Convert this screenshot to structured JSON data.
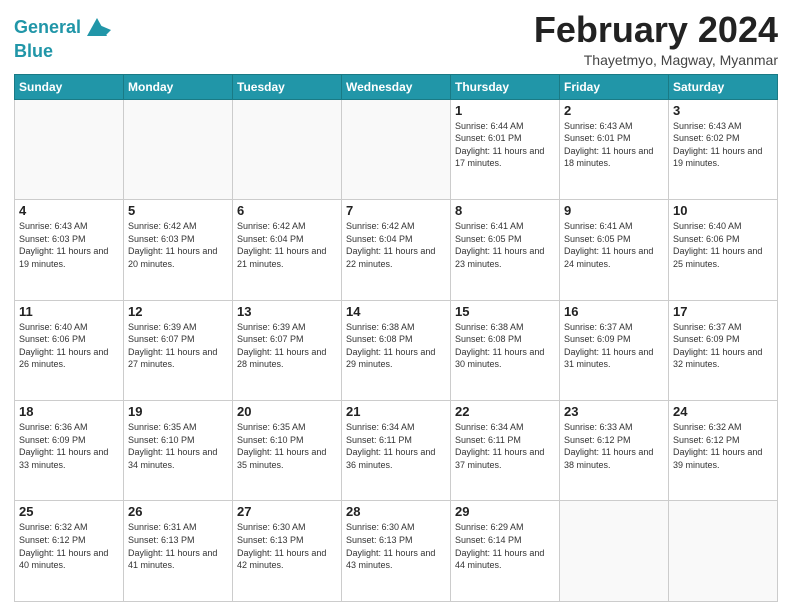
{
  "header": {
    "logo_line1": "General",
    "logo_line2": "Blue",
    "title": "February 2024",
    "subtitle": "Thayetmyo, Magway, Myanmar"
  },
  "days_of_week": [
    "Sunday",
    "Monday",
    "Tuesday",
    "Wednesday",
    "Thursday",
    "Friday",
    "Saturday"
  ],
  "weeks": [
    [
      {
        "day": "",
        "info": ""
      },
      {
        "day": "",
        "info": ""
      },
      {
        "day": "",
        "info": ""
      },
      {
        "day": "",
        "info": ""
      },
      {
        "day": "1",
        "info": "Sunrise: 6:44 AM\nSunset: 6:01 PM\nDaylight: 11 hours and 17 minutes."
      },
      {
        "day": "2",
        "info": "Sunrise: 6:43 AM\nSunset: 6:01 PM\nDaylight: 11 hours and 18 minutes."
      },
      {
        "day": "3",
        "info": "Sunrise: 6:43 AM\nSunset: 6:02 PM\nDaylight: 11 hours and 19 minutes."
      }
    ],
    [
      {
        "day": "4",
        "info": "Sunrise: 6:43 AM\nSunset: 6:03 PM\nDaylight: 11 hours and 19 minutes."
      },
      {
        "day": "5",
        "info": "Sunrise: 6:42 AM\nSunset: 6:03 PM\nDaylight: 11 hours and 20 minutes."
      },
      {
        "day": "6",
        "info": "Sunrise: 6:42 AM\nSunset: 6:04 PM\nDaylight: 11 hours and 21 minutes."
      },
      {
        "day": "7",
        "info": "Sunrise: 6:42 AM\nSunset: 6:04 PM\nDaylight: 11 hours and 22 minutes."
      },
      {
        "day": "8",
        "info": "Sunrise: 6:41 AM\nSunset: 6:05 PM\nDaylight: 11 hours and 23 minutes."
      },
      {
        "day": "9",
        "info": "Sunrise: 6:41 AM\nSunset: 6:05 PM\nDaylight: 11 hours and 24 minutes."
      },
      {
        "day": "10",
        "info": "Sunrise: 6:40 AM\nSunset: 6:06 PM\nDaylight: 11 hours and 25 minutes."
      }
    ],
    [
      {
        "day": "11",
        "info": "Sunrise: 6:40 AM\nSunset: 6:06 PM\nDaylight: 11 hours and 26 minutes."
      },
      {
        "day": "12",
        "info": "Sunrise: 6:39 AM\nSunset: 6:07 PM\nDaylight: 11 hours and 27 minutes."
      },
      {
        "day": "13",
        "info": "Sunrise: 6:39 AM\nSunset: 6:07 PM\nDaylight: 11 hours and 28 minutes."
      },
      {
        "day": "14",
        "info": "Sunrise: 6:38 AM\nSunset: 6:08 PM\nDaylight: 11 hours and 29 minutes."
      },
      {
        "day": "15",
        "info": "Sunrise: 6:38 AM\nSunset: 6:08 PM\nDaylight: 11 hours and 30 minutes."
      },
      {
        "day": "16",
        "info": "Sunrise: 6:37 AM\nSunset: 6:09 PM\nDaylight: 11 hours and 31 minutes."
      },
      {
        "day": "17",
        "info": "Sunrise: 6:37 AM\nSunset: 6:09 PM\nDaylight: 11 hours and 32 minutes."
      }
    ],
    [
      {
        "day": "18",
        "info": "Sunrise: 6:36 AM\nSunset: 6:09 PM\nDaylight: 11 hours and 33 minutes."
      },
      {
        "day": "19",
        "info": "Sunrise: 6:35 AM\nSunset: 6:10 PM\nDaylight: 11 hours and 34 minutes."
      },
      {
        "day": "20",
        "info": "Sunrise: 6:35 AM\nSunset: 6:10 PM\nDaylight: 11 hours and 35 minutes."
      },
      {
        "day": "21",
        "info": "Sunrise: 6:34 AM\nSunset: 6:11 PM\nDaylight: 11 hours and 36 minutes."
      },
      {
        "day": "22",
        "info": "Sunrise: 6:34 AM\nSunset: 6:11 PM\nDaylight: 11 hours and 37 minutes."
      },
      {
        "day": "23",
        "info": "Sunrise: 6:33 AM\nSunset: 6:12 PM\nDaylight: 11 hours and 38 minutes."
      },
      {
        "day": "24",
        "info": "Sunrise: 6:32 AM\nSunset: 6:12 PM\nDaylight: 11 hours and 39 minutes."
      }
    ],
    [
      {
        "day": "25",
        "info": "Sunrise: 6:32 AM\nSunset: 6:12 PM\nDaylight: 11 hours and 40 minutes."
      },
      {
        "day": "26",
        "info": "Sunrise: 6:31 AM\nSunset: 6:13 PM\nDaylight: 11 hours and 41 minutes."
      },
      {
        "day": "27",
        "info": "Sunrise: 6:30 AM\nSunset: 6:13 PM\nDaylight: 11 hours and 42 minutes."
      },
      {
        "day": "28",
        "info": "Sunrise: 6:30 AM\nSunset: 6:13 PM\nDaylight: 11 hours and 43 minutes."
      },
      {
        "day": "29",
        "info": "Sunrise: 6:29 AM\nSunset: 6:14 PM\nDaylight: 11 hours and 44 minutes."
      },
      {
        "day": "",
        "info": ""
      },
      {
        "day": "",
        "info": ""
      }
    ]
  ]
}
